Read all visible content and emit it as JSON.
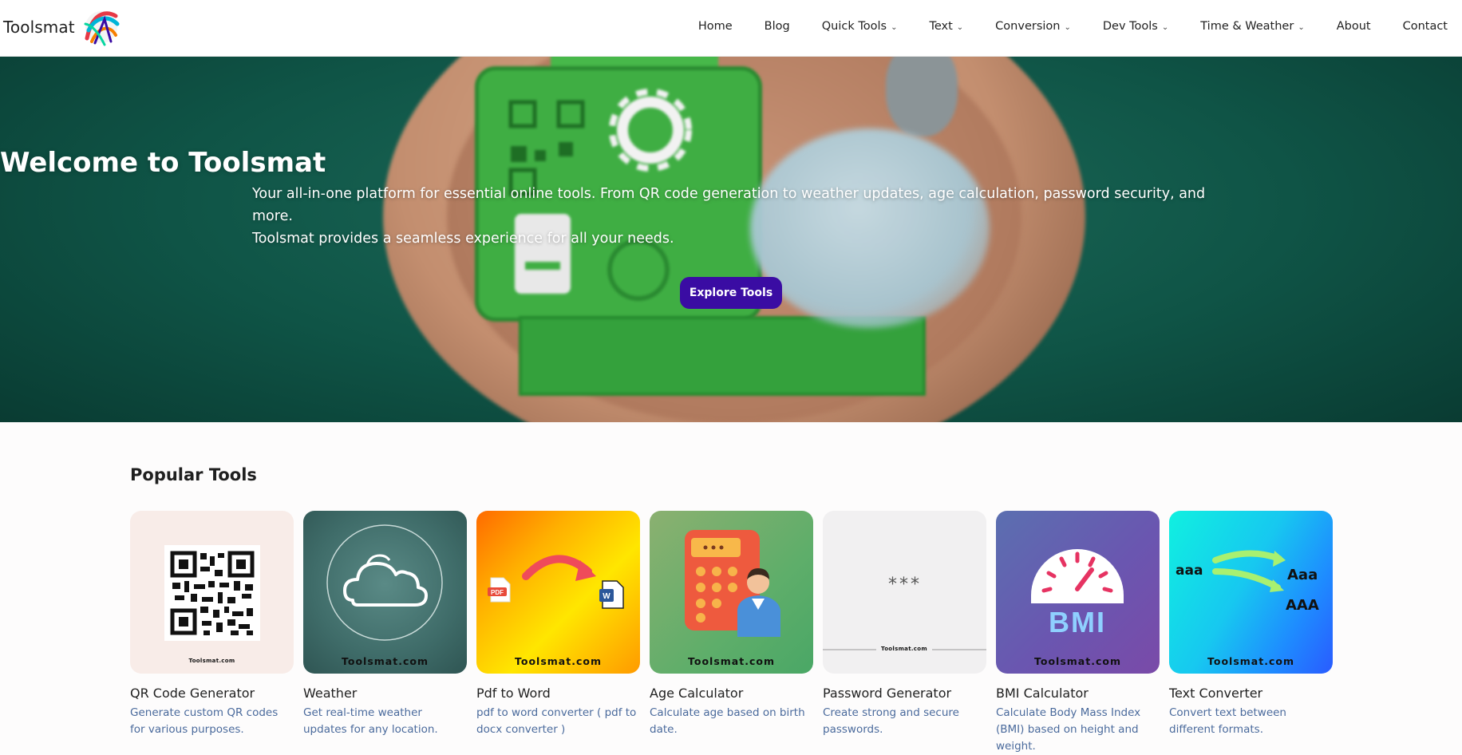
{
  "brand": {
    "name": "Toolsmat",
    "logo_icon": "toolsmat-logo-icon"
  },
  "nav": {
    "items": [
      {
        "label": "Home",
        "dropdown": false
      },
      {
        "label": "Blog",
        "dropdown": false
      },
      {
        "label": "Quick Tools",
        "dropdown": true
      },
      {
        "label": "Text",
        "dropdown": true
      },
      {
        "label": "Conversion",
        "dropdown": true
      },
      {
        "label": "Dev Tools",
        "dropdown": true
      },
      {
        "label": "Time & Weather",
        "dropdown": true
      },
      {
        "label": "About",
        "dropdown": false
      },
      {
        "label": "Contact",
        "dropdown": false
      }
    ],
    "caret_icon": "chevron-down-icon"
  },
  "hero": {
    "title": "Welcome to Toolsmat",
    "subtitle_line1": "Your all-in-one platform for essential online tools. From QR code generation to weather updates, age calculation, password security, and more.",
    "subtitle_line2": "Toolsmat provides a seamless experience for all your needs.",
    "button_label": "Explore Tools"
  },
  "popular": {
    "title": "Popular Tools",
    "watermark": "Toolsmat.com",
    "tools": [
      {
        "name": "QR Code Generator",
        "description": "Generate custom QR codes for various purposes.",
        "icon": "qr-code-icon"
      },
      {
        "name": "Weather",
        "description": "Get real-time weather updates for any location.",
        "icon": "cloud-icon"
      },
      {
        "name": "Pdf to Word",
        "description": "pdf to word converter ( pdf to docx converter )",
        "icon": "pdf-to-word-icon",
        "pdf_badge": "PDF",
        "word_badge": "W"
      },
      {
        "name": "Age Calculator",
        "description": "Calculate age based on birth date.",
        "icon": "calculator-icon"
      },
      {
        "name": "Password Generator",
        "description": "Create strong and secure passwords.",
        "icon": "password-icon",
        "mask": "***"
      },
      {
        "name": "BMI Calculator",
        "description": "Calculate Body Mass Index (BMI) based on height and weight.",
        "icon": "bmi-gauge-icon",
        "badge": "BMI"
      },
      {
        "name": "Text Converter",
        "description": "Convert text between different formats.",
        "icon": "text-case-icon",
        "samples": [
          "aaa",
          "Aaa",
          "AAA"
        ]
      }
    ]
  },
  "colors": {
    "accent_button": "#3a0ca3",
    "description_text": "#4a6a9c",
    "hero_green": "#0f5446"
  }
}
